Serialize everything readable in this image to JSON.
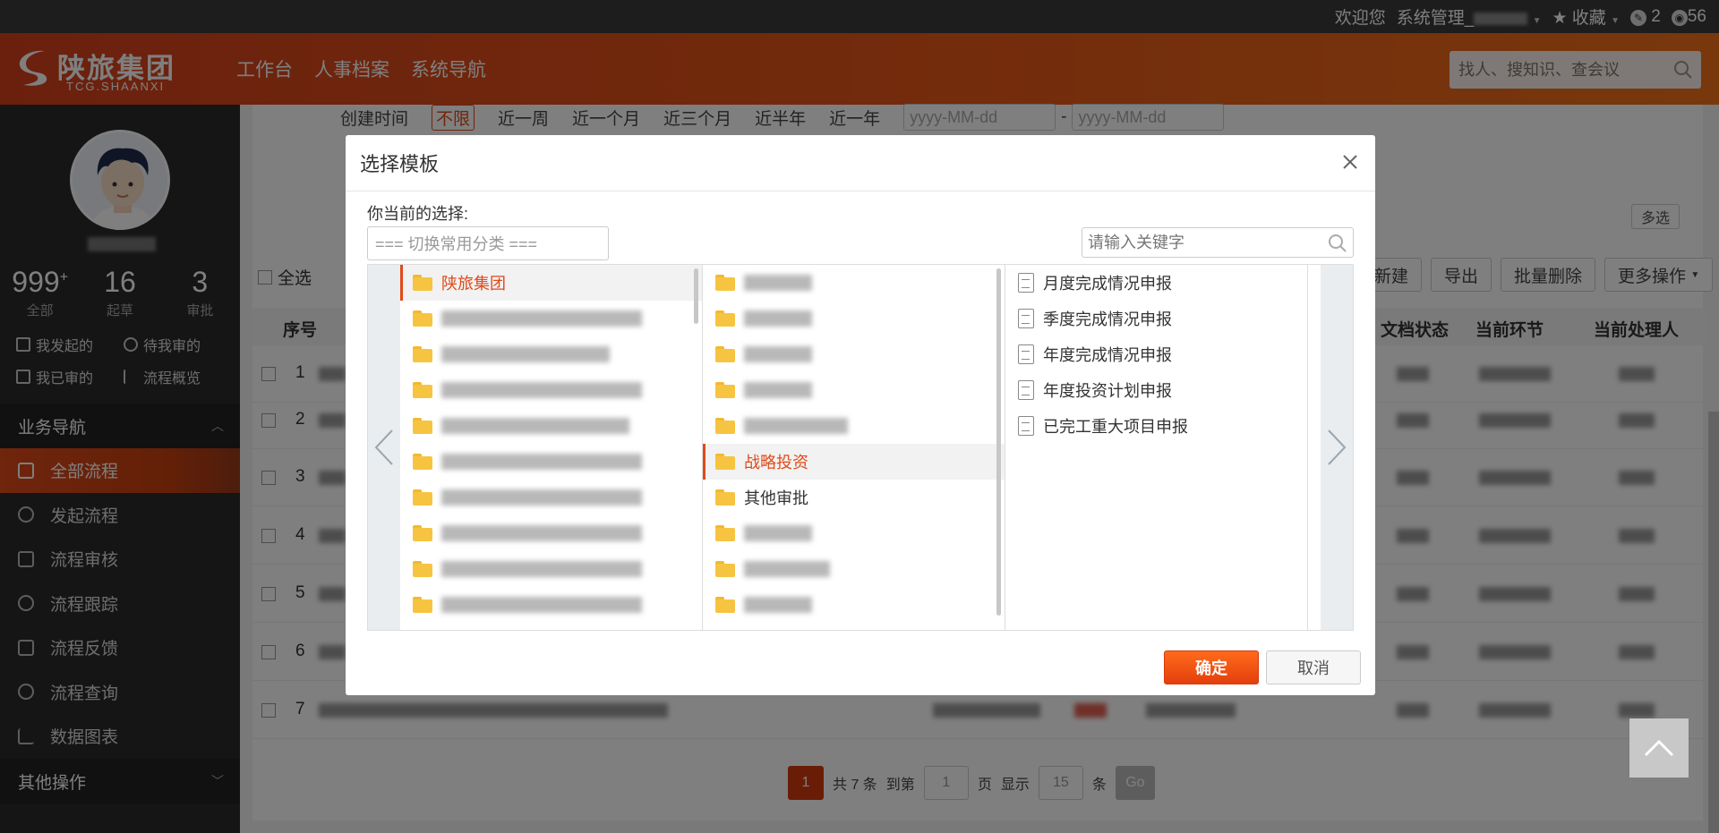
{
  "topbar": {
    "welcome": "欢迎您",
    "user_role": "系统管理_",
    "favorites": "收藏",
    "badge1": "2",
    "badge2": "56"
  },
  "header": {
    "logo_name": "陕旅集团",
    "logo_sub": "TCG.SHAANXI",
    "nav": [
      "工作台",
      "人事档案",
      "系统导航"
    ],
    "search_placeholder": "找人、搜知识、查会议",
    "accent_color": "#e85a18"
  },
  "sidebar": {
    "stats": [
      {
        "num": "999",
        "sup": "+",
        "label": "全部"
      },
      {
        "num": "16",
        "label": "起草"
      },
      {
        "num": "3",
        "label": "审批"
      }
    ],
    "quick": [
      "我发起的",
      "待我审的",
      "我已审的",
      "流程概览"
    ],
    "section_business": "业务导航",
    "menu": [
      "全部流程",
      "发起流程",
      "流程审核",
      "流程跟踪",
      "流程反馈",
      "流程查询",
      "数据图表"
    ],
    "section_other": "其他操作"
  },
  "main": {
    "filter_label": "创建时间",
    "filter_options": [
      "不限",
      "近一周",
      "近一个月",
      "近三个月",
      "近半年",
      "近一年"
    ],
    "date_placeholder": "yyyy-MM-dd",
    "multi_select": "多选",
    "select_all": "全选",
    "toolbar": [
      "新建",
      "导出",
      "批量删除",
      "更多操作"
    ],
    "columns": [
      "序号",
      "文档状态",
      "当前环节",
      "当前处理人"
    ],
    "rows": [
      "1",
      "2",
      "3",
      "4",
      "5",
      "6",
      "7"
    ],
    "pager": {
      "current": "1",
      "total_text": "共 7 条",
      "goto": "到第",
      "page_input": "1",
      "page_unit": "页",
      "show": "显示",
      "size": "15",
      "size_unit": "条",
      "go": "Go"
    }
  },
  "modal": {
    "title": "选择模板",
    "current_label": "你当前的选择:",
    "category_placeholder": "=== 切换常用分类 ===",
    "search_placeholder": "请输入关键字",
    "col1_selected": "陕旅集团",
    "col2_selected": "战略投资",
    "col2_other": "其他审批",
    "templates": [
      "月度完成情况申报",
      "季度完成情况申报",
      "年度完成情况申报",
      "年度投资计划申报",
      "已完工重大项目申报"
    ],
    "ok": "确定",
    "cancel": "取消"
  }
}
